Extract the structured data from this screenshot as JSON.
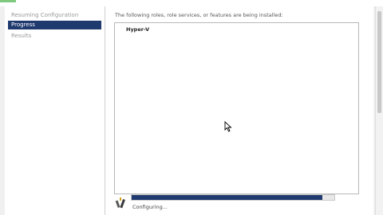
{
  "sidebar": {
    "items": [
      {
        "label": "Resuming Configuration"
      },
      {
        "label": "Progress"
      },
      {
        "label": "Results"
      }
    ]
  },
  "main": {
    "intro_text": "The following roles, role services, or features are being installed:",
    "items": [
      "Hyper-V"
    ]
  },
  "progress": {
    "value": 0.94,
    "status_text": "Configuring..."
  },
  "colors": {
    "accent": "#1f3a6f",
    "page_bg": "#f0f0f0",
    "panel_bg": "#ffffff"
  },
  "icons": {
    "status": "installing-icon",
    "cursor": "mouse-pointer-icon"
  }
}
